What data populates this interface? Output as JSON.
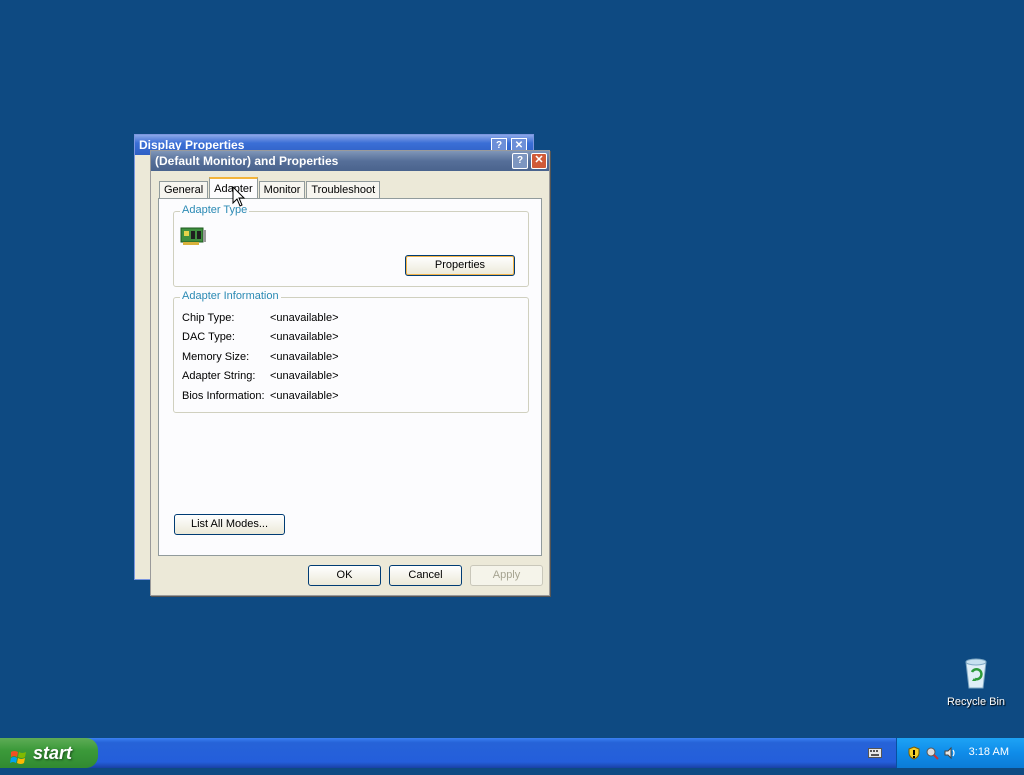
{
  "desktop": {
    "recycle_bin_label": "Recycle Bin"
  },
  "back_window": {
    "title": "Display Properties",
    "help_label": "?",
    "close_label": "✕"
  },
  "dialog": {
    "title": "(Default Monitor) and  Properties",
    "help_label": "?",
    "close_label": "✕",
    "tabs": [
      {
        "label": "General",
        "active": false
      },
      {
        "label": "Adapter",
        "active": true
      },
      {
        "label": "Monitor",
        "active": false
      },
      {
        "label": "Troubleshoot",
        "active": false
      }
    ],
    "adapter_type": {
      "legend": "Adapter Type",
      "icon": "video-card-icon",
      "properties_label": "Properties"
    },
    "adapter_info": {
      "legend": "Adapter Information",
      "rows": [
        {
          "key": "Chip Type:",
          "value": "<unavailable>"
        },
        {
          "key": "DAC Type:",
          "value": "<unavailable>"
        },
        {
          "key": "Memory Size:",
          "value": "<unavailable>"
        },
        {
          "key": "Adapter String:",
          "value": "<unavailable>"
        },
        {
          "key": "Bios Information:",
          "value": "<unavailable>"
        }
      ]
    },
    "list_all_modes_label": "List All Modes...",
    "ok_label": "OK",
    "cancel_label": "Cancel",
    "apply_label": "Apply"
  },
  "taskbar": {
    "start_label": "start",
    "clock": "3:18 AM"
  },
  "colors": {
    "desktop": "#0e4a82",
    "group_legend": "#2b8ab4",
    "taskbar": "#245edb",
    "start_button": "#3c9a3a"
  }
}
